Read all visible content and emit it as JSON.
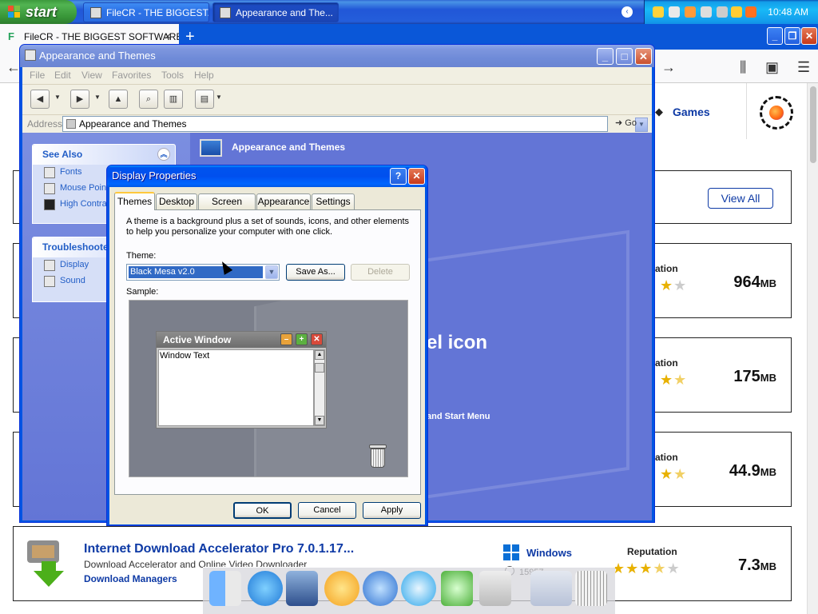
{
  "taskbar": {
    "start_label": "start",
    "tasks": [
      {
        "label": "FileCR - THE BIGGEST..."
      },
      {
        "label": "Appearance and The..."
      }
    ],
    "clock": "10:48 AM"
  },
  "browser": {
    "tab_title": "FileCR - THE BIGGEST SOFTWARE",
    "tab_close": "×",
    "new_tab": "+",
    "games_label": "Games",
    "view_all_label": "View All",
    "rows": [
      {
        "reputation": "ation",
        "stars": 4,
        "size": "964",
        "unit": "MB"
      },
      {
        "reputation": "ation",
        "stars": 3.5,
        "size": "175",
        "unit": "MB"
      },
      {
        "reputation": "ation",
        "stars": 3.5,
        "size": "44.9",
        "unit": "MB"
      }
    ],
    "product": {
      "title": "Internet Download Accelerator Pro 7.0.1.17...",
      "description": "Download Accelerator and Online Video Downloader",
      "category": "Download Managers",
      "platform": "Windows",
      "downloads": "15957",
      "reputation_label": "Reputation",
      "stars": 3,
      "size": "7.3",
      "unit": "MB"
    }
  },
  "control_panel": {
    "title": "Appearance and Themes",
    "menu": [
      "File",
      "Edit",
      "View",
      "Favorites",
      "Tools",
      "Help"
    ],
    "address_label": "Address",
    "address_value": "Appearance and Themes",
    "go_label": "Go",
    "see_also": {
      "title": "See Also",
      "items": [
        "Fonts",
        "Mouse Pointers",
        "High Contrast"
      ]
    },
    "troubleshooters": {
      "title": "Troubleshooters",
      "items": [
        "Display",
        "Sound"
      ]
    },
    "main_title": "Appearance and Themes",
    "partial_big_text": "el icon",
    "partial_small_text": "and Start Menu"
  },
  "display_properties": {
    "title": "Display Properties",
    "tabs": [
      "Themes",
      "Desktop",
      "Screen Saver",
      "Appearance",
      "Settings"
    ],
    "description": "A theme is a background plus a set of sounds, icons, and other elements to help you personalize your computer with one click.",
    "theme_label": "Theme:",
    "theme_value": "Black Mesa v2.0",
    "save_as_label": "Save As...",
    "delete_label": "Delete",
    "sample_label": "Sample:",
    "sample_window_title": "Active Window",
    "sample_window_text": "Window Text",
    "ok_label": "OK",
    "cancel_label": "Cancel",
    "apply_label": "Apply",
    "help_label": "?",
    "close_label": "✕"
  },
  "colors": {
    "xp_blue": "#0054e3",
    "link_blue": "#0e3aa5",
    "star": "#e8b100",
    "cp_body": "#6375d6"
  }
}
